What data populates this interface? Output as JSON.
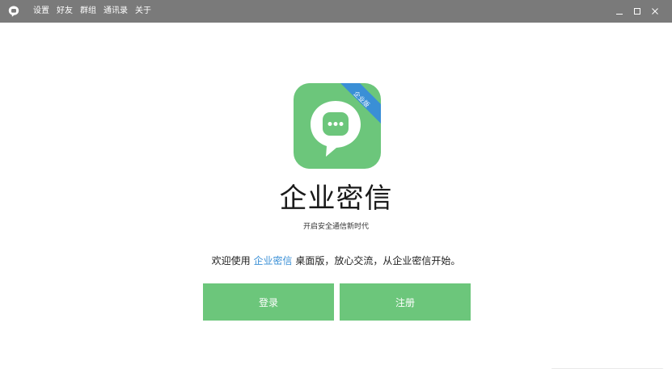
{
  "titlebar": {
    "menu": [
      "设置",
      "好友",
      "群组",
      "通讯录",
      "关于"
    ],
    "controls": {
      "minimize": "_",
      "maximize": "□",
      "close": "×"
    }
  },
  "logo": {
    "icon": "chat-bubble-icon",
    "ribbon_text": "企业版",
    "color": "#6cc67b",
    "ribbon_color": "#3a8fd6"
  },
  "main": {
    "app_name": "企业密信",
    "slogan": "开启安全通信新时代",
    "welcome_prefix": "欢迎使用 ",
    "welcome_link": "企业密信",
    "welcome_suffix": " 桌面版，放心交流，从企业密信开始。"
  },
  "buttons": {
    "login": "登录",
    "register": "注册"
  },
  "colors": {
    "titlebar": "#7a7a7a",
    "accent_green": "#6cc67b",
    "link_blue": "#3a8fd6"
  }
}
